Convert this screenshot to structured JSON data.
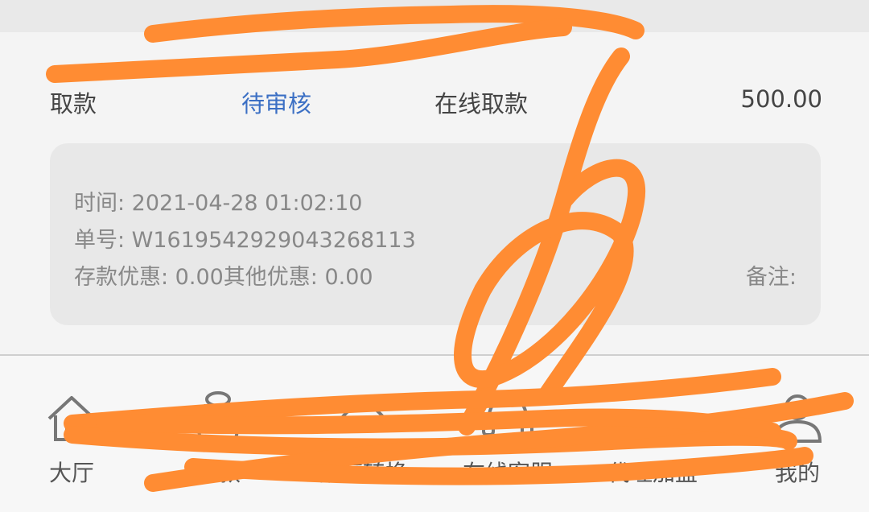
{
  "transaction": {
    "type": "取款",
    "status": "待审核",
    "method": "在线取款",
    "amount": "500.00"
  },
  "details": {
    "time": "时间: 2021-04-28 01:02:10",
    "order_no": "单号: W1619542929043268113",
    "discounts": "存款优惠: 0.00其他优惠: 0.00",
    "remark": "备注:"
  },
  "tabbar": {
    "items": [
      {
        "label": "大厅",
        "icon": "home-icon"
      },
      {
        "label": "存款",
        "icon": "deposit-bag-icon"
      },
      {
        "label": "额度转换",
        "icon": "transfer-icon"
      },
      {
        "label": "在线客服",
        "icon": "headset-icon"
      },
      {
        "label": "代理加盟",
        "icon": "handshake-icon"
      },
      {
        "label": "我的",
        "icon": "user-icon"
      }
    ]
  },
  "colors": {
    "status_blue": "#3b6fc4",
    "scribble_orange": "#ff8c33",
    "card_bg": "#e8e8e8"
  }
}
